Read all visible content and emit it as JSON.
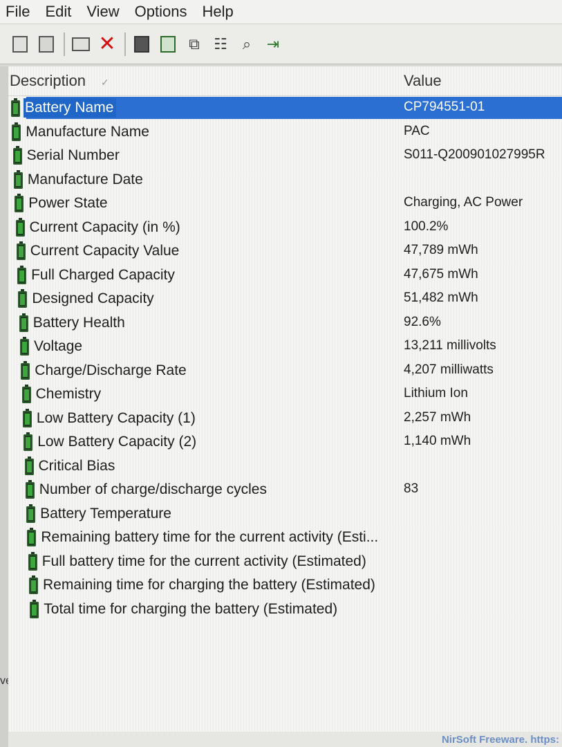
{
  "menu": [
    "File",
    "Edit",
    "View",
    "Options",
    "Help"
  ],
  "toolbar": {
    "icons": [
      "html-report-icon",
      "text-report-icon",
      "properties-icon",
      "delete-icon",
      "save-icon",
      "refresh-icon",
      "copy-icon",
      "options-icon",
      "find-icon",
      "exit-icon"
    ]
  },
  "columns": {
    "description": "Description",
    "value": "Value",
    "sort_glyph": "✓"
  },
  "rows": [
    {
      "description": "Battery Name",
      "value": "CP794551-01",
      "selected": true
    },
    {
      "description": "Manufacture Name",
      "value": "PAC"
    },
    {
      "description": "Serial Number",
      "value": "S011-Q200901027995R"
    },
    {
      "description": "Manufacture Date",
      "value": ""
    },
    {
      "description": "Power State",
      "value": "Charging, AC Power"
    },
    {
      "description": "Current Capacity (in %)",
      "value": "100.2%"
    },
    {
      "description": "Current Capacity Value",
      "value": "47,789 mWh"
    },
    {
      "description": "Full Charged Capacity",
      "value": "47,675 mWh"
    },
    {
      "description": "Designed Capacity",
      "value": "51,482 mWh"
    },
    {
      "description": "Battery Health",
      "value": "92.6%"
    },
    {
      "description": "Voltage",
      "value": "13,211 millivolts"
    },
    {
      "description": "Charge/Discharge Rate",
      "value": "4,207 milliwatts"
    },
    {
      "description": "Chemistry",
      "value": "Lithium Ion"
    },
    {
      "description": "Low Battery Capacity (1)",
      "value": "2,257 mWh"
    },
    {
      "description": "Low Battery Capacity (2)",
      "value": "1,140 mWh"
    },
    {
      "description": "Critical Bias",
      "value": ""
    },
    {
      "description": "Number of charge/discharge cycles",
      "value": "83"
    },
    {
      "description": "Battery Temperature",
      "value": ""
    },
    {
      "description": "Remaining battery time for the current activity (Esti...",
      "value": ""
    },
    {
      "description": "Full battery time for the current activity (Estimated)",
      "value": ""
    },
    {
      "description": "Remaining time for charging the battery (Estimated)",
      "value": ""
    },
    {
      "description": "Total time for charging the battery (Estimated)",
      "value": ""
    }
  ],
  "left_fragments": [
    "ve"
  ],
  "watermark": "NirSoft Freeware. https:",
  "colors": {
    "selection": "#2a6fd1",
    "battery_green": "#3fa53f"
  }
}
